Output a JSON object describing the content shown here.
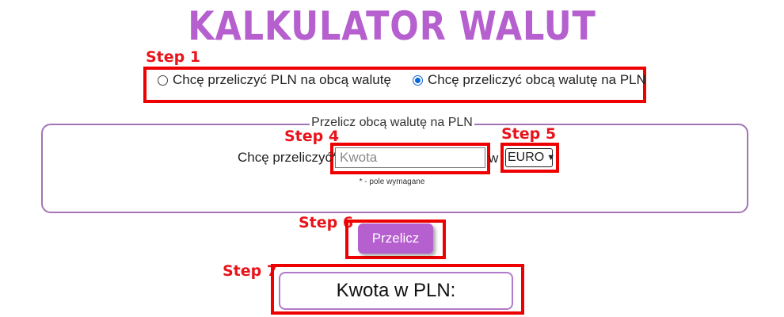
{
  "page": {
    "title": "KALKULATOR WALUT"
  },
  "steps": [
    "Step 1",
    "Step 4",
    "Step 5",
    "Step 6",
    "Step 7"
  ],
  "direction": {
    "options": [
      {
        "label": "Chcę przeliczyć PLN na obcą walutę",
        "selected": false
      },
      {
        "label": "Chcę przeliczyć obcą walutę na PLN",
        "selected": true
      }
    ]
  },
  "form": {
    "legend": "Przelicz obcą walutę na PLN",
    "amount_label": "Chcę przeliczyć*",
    "amount_value": "",
    "amount_placeholder": "Kwota",
    "in_label": "w",
    "currency_selected": "EURO",
    "required_note": "* - pole wymagane"
  },
  "convert_button": {
    "label": "Przelicz"
  },
  "result": {
    "label": "Kwota w PLN:"
  },
  "colors": {
    "accent": "#b65fcf",
    "annotation": "#ee0000",
    "radio_selected": "#0a66d6"
  }
}
